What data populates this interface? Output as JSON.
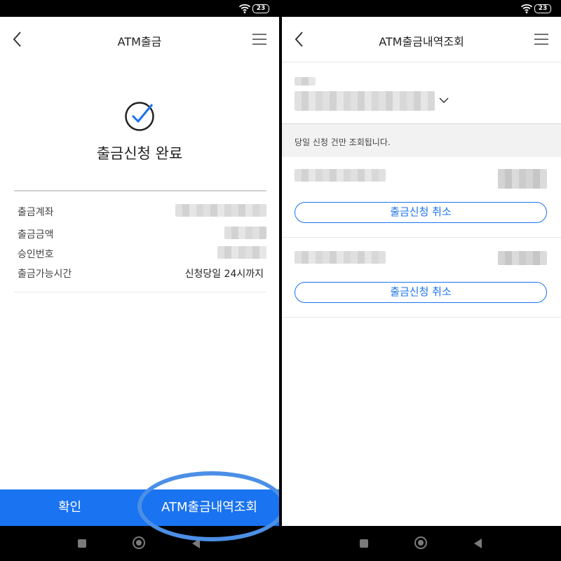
{
  "left_screen": {
    "status": {
      "battery": "23"
    },
    "header": {
      "title": "ATM출금"
    },
    "result": {
      "title": "출금신청 완료"
    },
    "details": [
      {
        "label": "출금계좌",
        "value": ""
      },
      {
        "label": "출금금액",
        "value": ""
      },
      {
        "label": "승인번호",
        "value": ""
      },
      {
        "label": "출금가능시간",
        "value": "신청당일 24시까지"
      }
    ],
    "buttons": {
      "confirm": "확인",
      "history": "ATM출금내역조회"
    }
  },
  "right_screen": {
    "status": {
      "battery": "23"
    },
    "header": {
      "title": "ATM출금내역조회"
    },
    "notice": "당일 신청 건만 조회됩니다.",
    "items": [
      {
        "cancel_label": "출금신청 취소"
      },
      {
        "cancel_label": "출금신청 취소"
      }
    ]
  },
  "colors": {
    "accent": "#1a73f0",
    "highlight": "#4b8fe6"
  },
  "icons": [
    "back-arrow-icon",
    "menu-icon",
    "check-circle-icon",
    "chevron-down-icon",
    "wifi-icon",
    "battery-icon"
  ]
}
